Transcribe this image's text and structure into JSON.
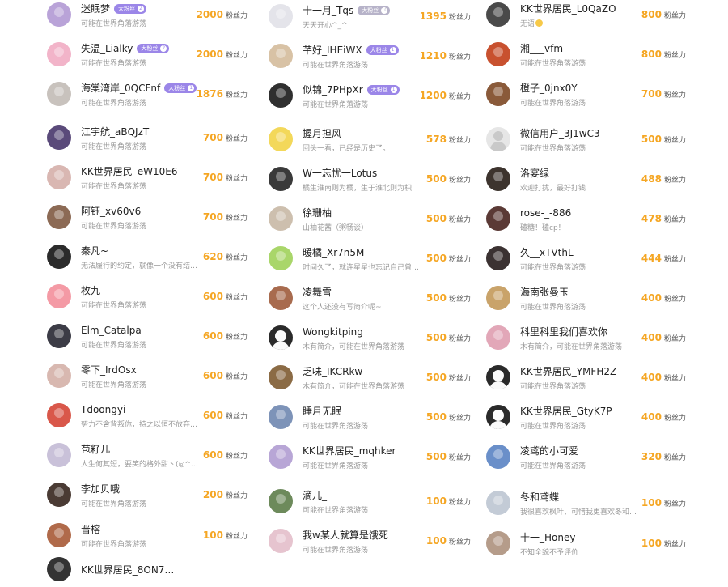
{
  "fans_unit_label": "粉丝力",
  "badge_label": "大粉丝",
  "columns": [
    [
      {
        "name": "迷眠梦",
        "sig": "可能在世界角落游荡",
        "fans": "2000",
        "badge": true,
        "level": "2",
        "color": "#b9a3d8"
      },
      {
        "name": "失温_Lialky",
        "sig": "可能在世界角落游荡",
        "fans": "2000",
        "badge": true,
        "level": "2",
        "color": "#f2b4c9"
      },
      {
        "name": "海棠湾岸_0QCFnf",
        "sig": "可能在世界角落游荡",
        "fans": "1876",
        "badge": true,
        "level": "1",
        "color": "#c8c2bd"
      },
      {
        "name": "江宇航_aBQJzT",
        "sig": "可能在世界角落游荡",
        "fans": "700",
        "color": "#5a4a7a"
      },
      {
        "name": "KK世界居民_eW10E6",
        "sig": "可能在世界角落游荡",
        "fans": "700",
        "color": "#d9b7b2"
      },
      {
        "name": "阿钰_xv60v6",
        "sig": "可能在世界角落游荡",
        "fans": "700",
        "color": "#8c6a55"
      },
      {
        "name": "秦凡~",
        "sig": "无法履行的约定，就像一个没有结…",
        "fans": "620",
        "color": "#2b2b2b"
      },
      {
        "name": "枚九",
        "sig": "可能在世界角落游荡",
        "fans": "600",
        "color": "#f49aa5"
      },
      {
        "name": "Elm_Catalpa",
        "sig": "可能在世界角落游荡",
        "fans": "600",
        "color": "#3c3c46"
      },
      {
        "name": "零下_IrdOsx",
        "sig": "可能在世界角落游荡",
        "fans": "600",
        "color": "#d8b8b0"
      },
      {
        "name": "Tdoongyi",
        "sig": "努力不會背叛你，持之以恒不放弃…",
        "fans": "600",
        "color": "#d9574a"
      },
      {
        "name": "苞籽儿",
        "sig": "人生何其短，要笑的格外甜丶(◎^…",
        "fans": "600",
        "color": "#c9c1d9"
      },
      {
        "name": "李加贝哦",
        "sig": "可能在世界角落游荡",
        "fans": "200",
        "color": "#4a3b34"
      },
      {
        "name": "晋榕",
        "sig": "可能在世界角落游荡",
        "fans": "100",
        "color": "#b06a4a"
      },
      {
        "name": "KK世界居民_8ON7…",
        "sig": "",
        "fans": "",
        "color": "#333333"
      }
    ],
    [
      {
        "name": "十一月_Tqs",
        "sig": "天天开心^_^",
        "fans": "1395",
        "badge": true,
        "level": "10",
        "gray": true,
        "color": "#e4e4ea"
      },
      {
        "name": "芊好_IHEiWX",
        "sig": "可能在世界角落游荡",
        "fans": "1210",
        "badge": true,
        "level": "1",
        "color": "#d8c2a5"
      },
      {
        "name": "似锦_7PHpXr",
        "sig": "可能在世界角落游荡",
        "fans": "1200",
        "badge": true,
        "level": "1",
        "color": "#2f2f2f"
      },
      {
        "name": "握月担风",
        "sig": "回头一看，已经是历史了。",
        "fans": "578",
        "color": "#f3d85a"
      },
      {
        "name": "W一忘忧一Lotus",
        "sig": "橘生淮南则为橘，生于淮北则为枳",
        "fans": "500",
        "color": "#3a3a3a"
      },
      {
        "name": "徐珊柚",
        "sig": "山柚花茜（粥畅谈）",
        "fans": "500",
        "color": "#cdbfae"
      },
      {
        "name": "暖橘_Xr7n5M",
        "sig": "时间久了，就连星星也忘记自己曾…",
        "fans": "500",
        "color": "#a9d66a"
      },
      {
        "name": "凌舞雪",
        "sig": "这个人还没有写简介呢~",
        "fans": "500",
        "color": "#a86b4e"
      },
      {
        "name": "Wongkitping",
        "sig": "木有简介，可能在世界角落游荡",
        "fans": "500",
        "default": "dark",
        "color": "#2a2a2a"
      },
      {
        "name": "乏味_IKCRkw",
        "sig": "木有简介，可能在世界角落游荡",
        "fans": "500",
        "color": "#8b6b45"
      },
      {
        "name": "睡月无眠",
        "sig": "可能在世界角落游荡",
        "fans": "500",
        "color": "#7d93b8"
      },
      {
        "name": "KK世界居民_mqhker",
        "sig": "可能在世界角落游荡",
        "fans": "500",
        "color": "#b8a6d6"
      },
      {
        "name": "滴儿_",
        "sig": "可能在世界角落游荡",
        "fans": "100",
        "color": "#6d8a5b"
      },
      {
        "name": "我w某人就算是饿死",
        "sig": "可能在世界角落游荡",
        "fans": "100",
        "color": "#e6c4cf"
      }
    ],
    [
      {
        "name": "KK世界居民_L0QaZO",
        "sig": "无语",
        "sig_emoji": true,
        "fans": "800",
        "color": "#4a4a4a"
      },
      {
        "name": "湘___vfm",
        "sig": "可能在世界角落游荡",
        "fans": "800",
        "color": "#c8512f"
      },
      {
        "name": "橙子_0jnx0Y",
        "sig": "可能在世界角落游荡",
        "fans": "700",
        "color": "#8a5a3a"
      },
      {
        "name": "微信用户_3J1wC3",
        "sig": "可能在世界角落游荡",
        "fans": "500",
        "default": "light",
        "color": "#e6e6e6"
      },
      {
        "name": "洛宴绿",
        "sig": "欢迎打扰，最好打钱",
        "fans": "488",
        "color": "#3d342e"
      },
      {
        "name": "rose-_-886",
        "sig": "磕糖！磕cp！",
        "fans": "478",
        "color": "#5b3a36"
      },
      {
        "name": "久__xTVthL",
        "sig": "可能在世界角落游荡",
        "fans": "444",
        "color": "#3b3232"
      },
      {
        "name": "海南张曼玉",
        "sig": "可能在世界角落游荡",
        "fans": "400",
        "color": "#c9a36a"
      },
      {
        "name": "科里科里我们喜欢你",
        "sig": "木有简介，可能在世界角落游荡",
        "fans": "400",
        "color": "#e2a7b8"
      },
      {
        "name": "KK世界居民_YMFH2Z",
        "sig": "可能在世界角落游荡",
        "fans": "400",
        "default": "dark",
        "color": "#2a2a2a"
      },
      {
        "name": "KK世界居民_GtyK7P",
        "sig": "可能在世界角落游荡",
        "fans": "400",
        "default": "dark",
        "color": "#2a2a2a"
      },
      {
        "name": "凌鸢的小可爱",
        "sig": "可能在世界角落游荡",
        "fans": "320",
        "color": "#6a8fc9"
      },
      {
        "name": "冬和鸢蝶",
        "sig": "我很喜欢枫叶，可惜我更喜欢冬和…",
        "fans": "100",
        "color": "#c3cbd6"
      },
      {
        "name": "十一_Honey",
        "sig": "不知全貌不予评价",
        "fans": "100",
        "color": "#b59c8a"
      }
    ]
  ]
}
